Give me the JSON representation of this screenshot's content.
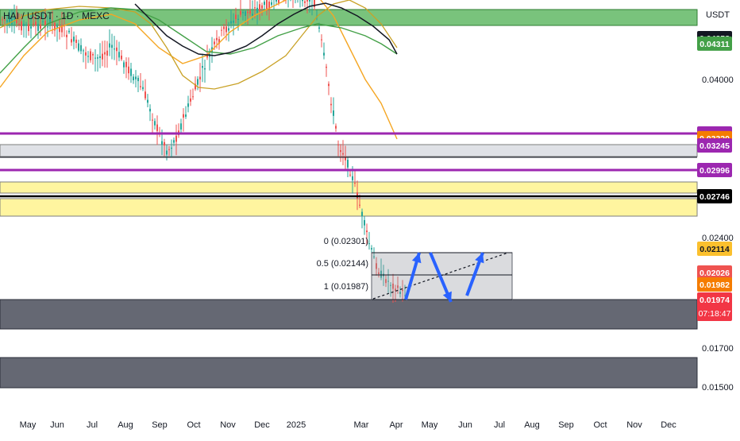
{
  "header": {
    "symbol": "HAI / USDT · 1D · MEXC",
    "currency": "USDT"
  },
  "chart_data": {
    "type": "candlestick",
    "x_ticks": [
      "May",
      "Jun",
      "Jul",
      "Aug",
      "Sep",
      "Oct",
      "Nov",
      "Dec",
      "2025",
      "Mar",
      "Apr",
      "May",
      "Jun",
      "Jul",
      "Aug",
      "Sep",
      "Oct",
      "Nov",
      "Dec"
    ],
    "y_ticks": [
      "0.04000",
      "0.02400",
      "0.01700",
      "0.01500"
    ],
    "price_labels": [
      {
        "text": "0.04358",
        "value": 0.04358,
        "color": "#131722",
        "text_color": "#ffffff"
      },
      {
        "text": "0.04311",
        "value": 0.04311,
        "color": "#43a047",
        "text_color": "#ffffff"
      },
      {
        "text": "0.03369",
        "value": 0.03369,
        "color": "#9c27b0",
        "text_color": "#ffffff"
      },
      {
        "text": "0.03320",
        "value": 0.0332,
        "color": "#f57c00",
        "text_color": "#ffffff"
      },
      {
        "text": "0.03245",
        "value": 0.03245,
        "color": "#9c27b0",
        "text_color": "#ffffff"
      },
      {
        "text": "0.02996",
        "value": 0.02996,
        "color": "#9c27b0",
        "text_color": "#ffffff"
      },
      {
        "text": "0.02746",
        "value": 0.02746,
        "color": "#000000",
        "text_color": "#ffffff"
      },
      {
        "text": "0.02114",
        "value": 0.02114,
        "color": "#fbc02d",
        "text_color": "#131722"
      },
      {
        "text": "0.02026",
        "value": 0.02026,
        "color": "#ef5350",
        "text_color": "#ffffff"
      },
      {
        "text": "0.01982",
        "value": 0.01982,
        "color": "#f57c00",
        "text_color": "#ffffff"
      },
      {
        "text": "0.01974",
        "value": 0.01974,
        "color": "#f23645",
        "text_color": "#ffffff",
        "subtext": "07:18:47"
      }
    ],
    "zones": [
      {
        "name": "green-resistance-zone",
        "color": "#4caf50"
      },
      {
        "name": "gray-zone",
        "color": "#d1d4dc"
      },
      {
        "name": "yellow-zone-1",
        "color": "#fff176"
      },
      {
        "name": "yellow-zone-2",
        "color": "#fff176"
      },
      {
        "name": "dark-support-zone-1",
        "color": "#5d606b"
      },
      {
        "name": "dark-support-zone-2",
        "color": "#5d606b"
      }
    ],
    "fib_levels": [
      {
        "label": "0 (0.02301)",
        "value": 0.02301
      },
      {
        "label": "0.5 (0.02144)",
        "value": 0.02144
      },
      {
        "label": "1 (0.01987)",
        "value": 0.01987
      }
    ],
    "colors": {
      "up": "#26a69a",
      "down": "#ef5350",
      "ma_orange": "#f5a623",
      "ma_black": "#131722",
      "ma_green": "#43a047",
      "ma_olive": "#c9a227",
      "arrow": "#2962ff",
      "purple": "#9c27b0"
    }
  }
}
